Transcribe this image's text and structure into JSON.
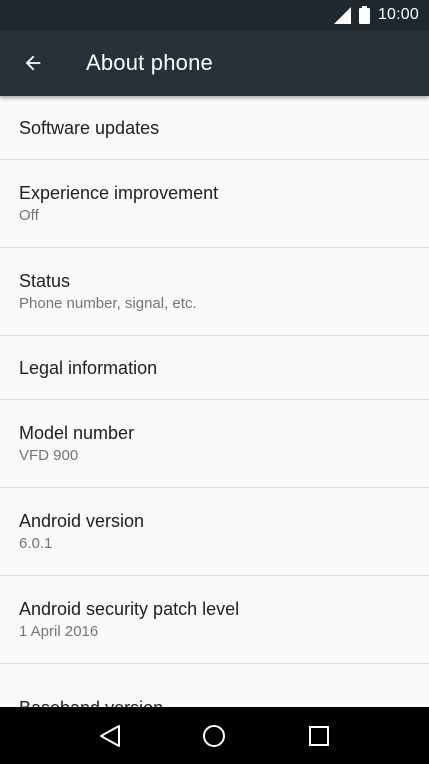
{
  "status_bar": {
    "time": "10:00",
    "icons": [
      "signal-icon",
      "battery-icon"
    ]
  },
  "toolbar": {
    "title": "About phone",
    "back_icon": "arrow-left-icon"
  },
  "items": [
    {
      "title": "Software updates",
      "summary": ""
    },
    {
      "title": "Experience improvement",
      "summary": "Off"
    },
    {
      "title": "Status",
      "summary": "Phone number, signal, etc."
    },
    {
      "title": "Legal information",
      "summary": ""
    },
    {
      "title": "Model number",
      "summary": "VFD 900"
    },
    {
      "title": "Android version",
      "summary": "6.0.1"
    },
    {
      "title": "Android security patch level",
      "summary": "1 April 2016"
    },
    {
      "title": "Baseband version",
      "summary": ""
    }
  ],
  "nav_bar": {
    "icons": [
      "back-triangle-icon",
      "home-circle-icon",
      "recents-square-icon"
    ]
  },
  "colors": {
    "toolbar": "#263238",
    "status_bar": "#1f282e",
    "background": "#fafafa",
    "divider": "#dcdcdc",
    "primary_text": "#212121",
    "secondary_text": "#757575"
  }
}
